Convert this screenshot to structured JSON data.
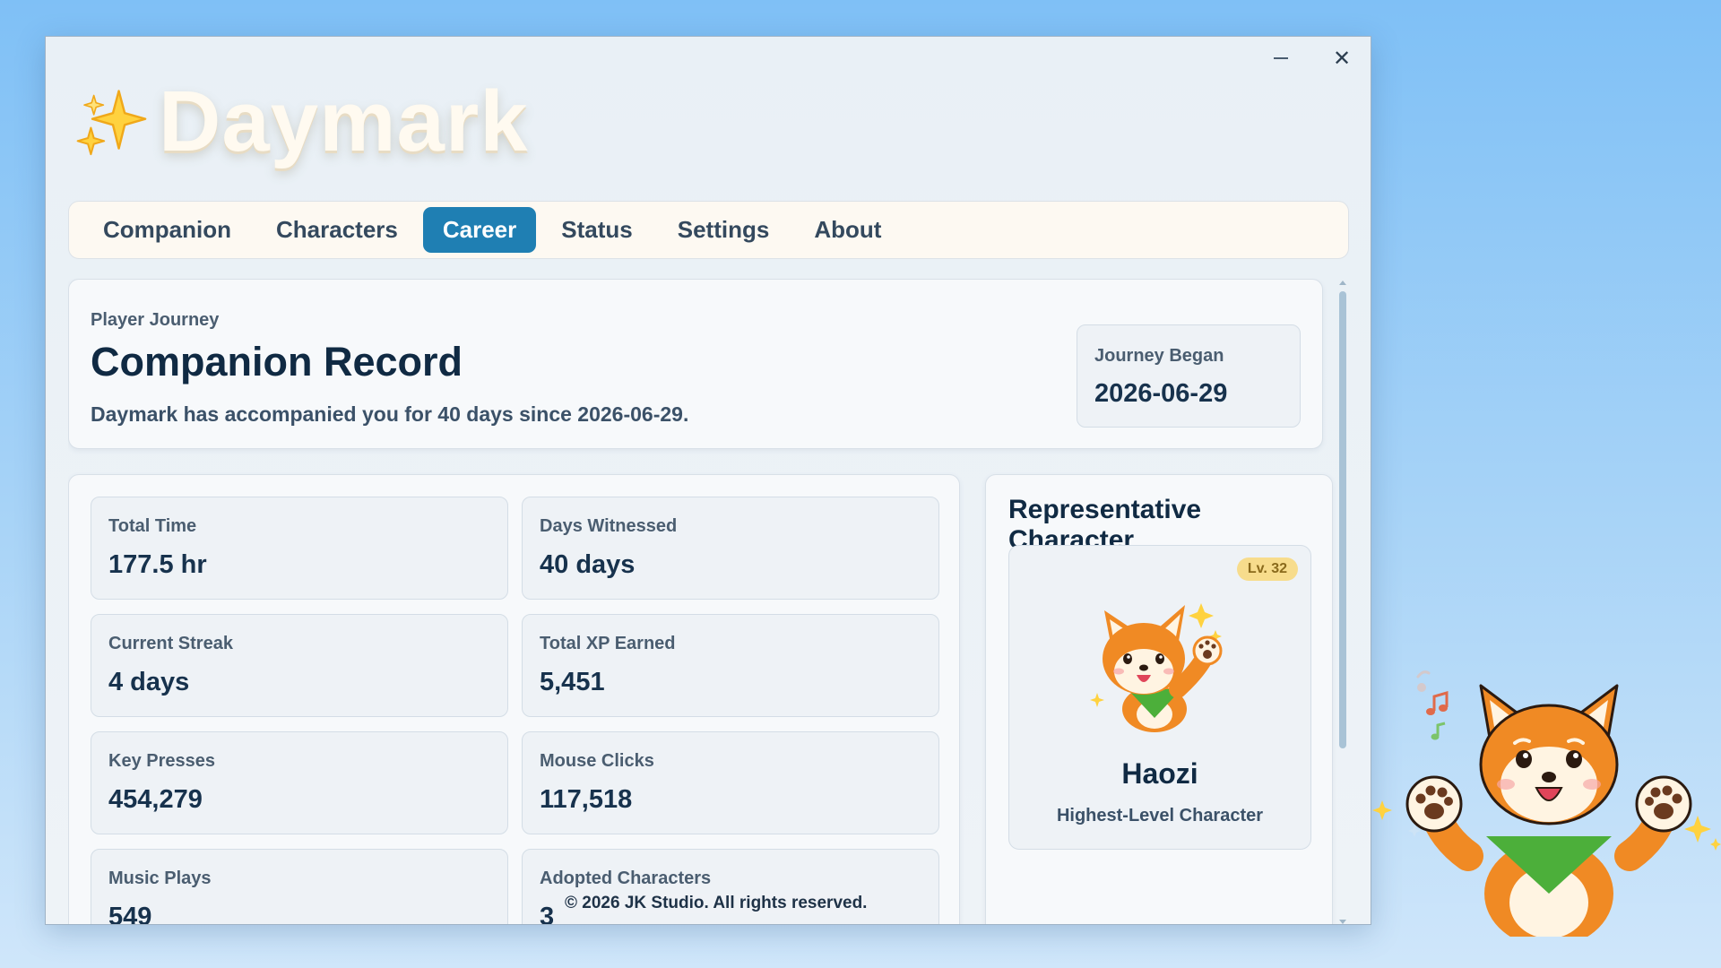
{
  "app": {
    "title": "Daymark",
    "window_controls": {
      "minimize_icon": "minimize-icon",
      "close_icon": "close-icon"
    }
  },
  "tabs": [
    {
      "label": "Companion",
      "active": false
    },
    {
      "label": "Characters",
      "active": false
    },
    {
      "label": "Career",
      "active": true
    },
    {
      "label": "Status",
      "active": false
    },
    {
      "label": "Settings",
      "active": false
    },
    {
      "label": "About",
      "active": false
    }
  ],
  "journey": {
    "kicker": "Player Journey",
    "title": "Companion Record",
    "description": "Daymark has accompanied you for 40 days since 2026-06-29.",
    "began_label": "Journey Began",
    "began_value": "2026-06-29"
  },
  "stats": [
    {
      "label": "Total Time",
      "value": "177.5 hr"
    },
    {
      "label": "Days Witnessed",
      "value": "40 days"
    },
    {
      "label": "Current Streak",
      "value": "4 days"
    },
    {
      "label": "Total XP Earned",
      "value": "5,451"
    },
    {
      "label": "Key Presses",
      "value": "454,279"
    },
    {
      "label": "Mouse Clicks",
      "value": "117,518"
    },
    {
      "label": "Music Plays",
      "value": "549"
    },
    {
      "label": "Adopted Characters",
      "value": "3"
    }
  ],
  "representative": {
    "title": "Representative Character",
    "level_badge": "Lv. 32",
    "name": "Haozi",
    "subtitle": "Highest-Level Character"
  },
  "footer": "© 2026 JK Studio. All rights reserved.",
  "colors": {
    "accent": "#1f7fb3",
    "title_text": "#102a43",
    "badge_bg": "#f7dc8c",
    "shiba_orange": "#f08a24",
    "bandana_green": "#4caf3a"
  }
}
